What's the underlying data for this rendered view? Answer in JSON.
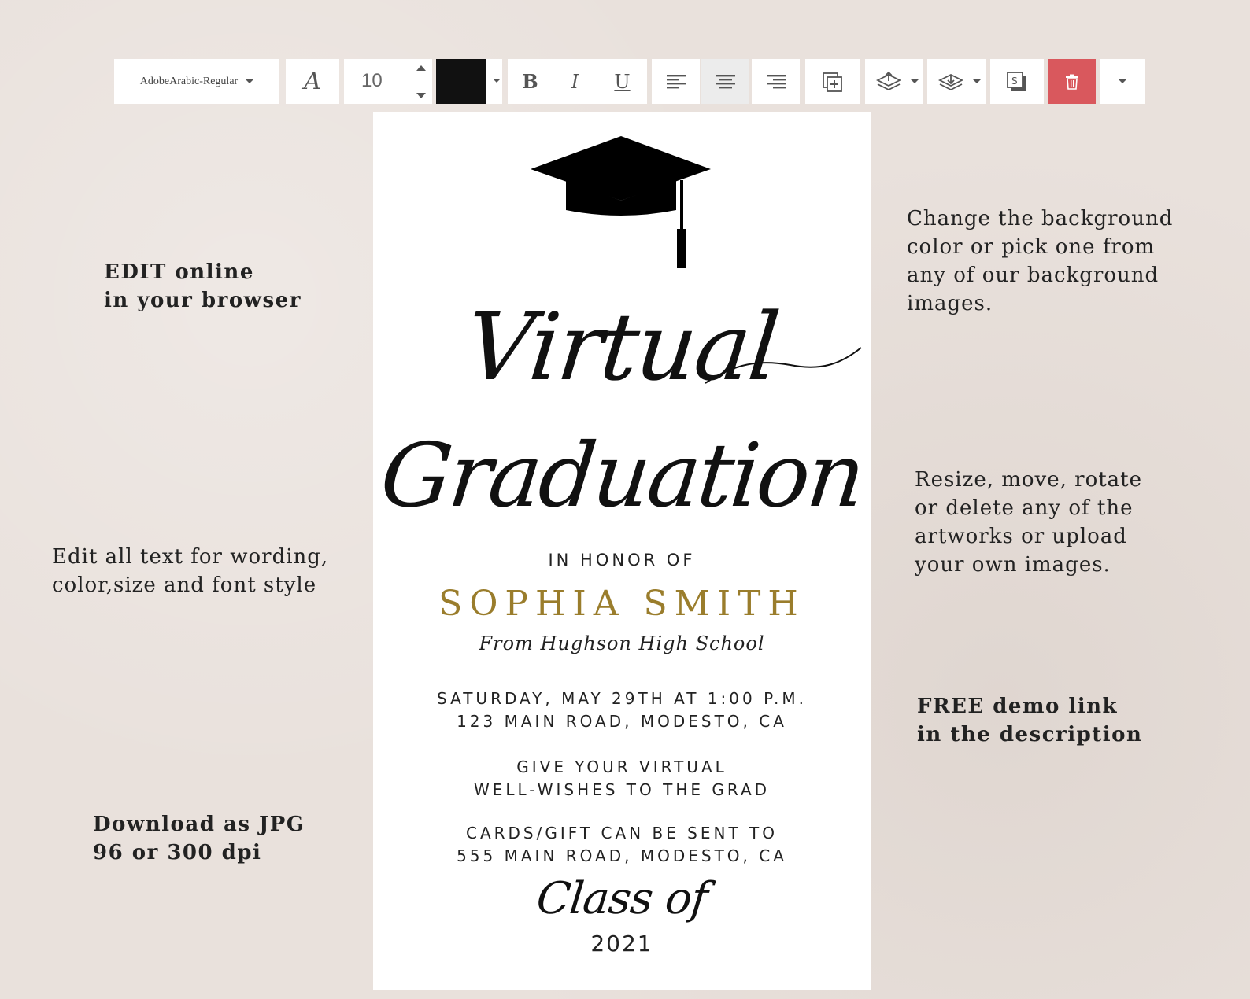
{
  "toolbar": {
    "font_name": "AdobeArabic-Regular",
    "font_size": "10",
    "text_color": "#111111",
    "bold_label": "B",
    "italic_label": "I",
    "underline_label": "U",
    "style_glyph": "A",
    "align_selected": "center",
    "delete_color": "#d9585d",
    "icons": [
      "font-style-icon",
      "align-left-icon",
      "align-center-icon",
      "align-right-icon",
      "add-element-icon",
      "bring-forward-icon",
      "send-backward-icon",
      "duplicate-icon",
      "trash-icon",
      "more-options-icon"
    ]
  },
  "card": {
    "title_line1": "Virtual",
    "title_line2": "Graduation",
    "honor": "IN HONOR OF",
    "name": "SOPHIA SMITH",
    "name_color": "#9a7d2c",
    "school": "From Hughson High School",
    "date_line": "SATURDAY, MAY 29TH AT 1:00 P.M.",
    "address_line": "123 MAIN ROAD, MODESTO, CA",
    "wishes_line1": "GIVE YOUR VIRTUAL",
    "wishes_line2": "WELL-WISHES TO THE GRAD",
    "gift_line1": "CARDS/GIFT CAN BE SENT TO",
    "gift_line2": "555 MAIN ROAD, MODESTO, CA",
    "class_of": "Class of",
    "year": "2021"
  },
  "notes": {
    "edit_online_1": "EDIT online",
    "edit_online_2": "in your browser",
    "edit_text_1": "Edit all text for wording,",
    "edit_text_2": "color,size and font style",
    "download_1": "Download as JPG",
    "download_2": "96 or 300 dpi",
    "background_1": "Change the background",
    "background_2": "color or pick one from",
    "background_3": "any of our background",
    "background_4": "images.",
    "resize_1": "Resize, move, rotate",
    "resize_2": "or delete any of the",
    "resize_3": "artworks or upload",
    "resize_4": "your own images.",
    "demo_1": "FREE demo link",
    "demo_2": "in the description"
  }
}
